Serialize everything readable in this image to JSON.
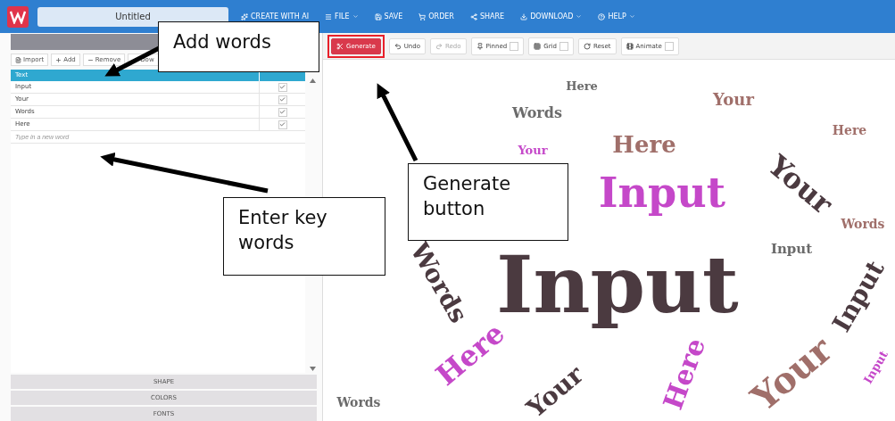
{
  "app_bar": {
    "document_title": "Untitled",
    "menu": [
      {
        "label": "CREATE WITH AI",
        "kind": "ai",
        "dropdown": false
      },
      {
        "label": "FILE",
        "kind": "menu",
        "dropdown": true
      },
      {
        "label": "SAVE",
        "kind": "save",
        "dropdown": false
      },
      {
        "label": "ORDER",
        "kind": "cart",
        "dropdown": false
      },
      {
        "label": "SHARE",
        "kind": "share",
        "dropdown": false
      },
      {
        "label": "DOWNLOAD",
        "kind": "download",
        "dropdown": true
      },
      {
        "label": "HELP",
        "kind": "help",
        "dropdown": true
      }
    ]
  },
  "words_panel": {
    "toolbar": [
      {
        "label": "Import",
        "kind": "file"
      },
      {
        "label": "Add",
        "kind": "plus"
      },
      {
        "label": "Remove",
        "kind": "minus"
      },
      {
        "label": "Dow",
        "kind": "down"
      }
    ],
    "column": "Text",
    "rows": [
      {
        "text": "Input",
        "checked": true
      },
      {
        "text": "Your",
        "checked": true
      },
      {
        "text": "Words",
        "checked": true
      },
      {
        "text": "Here",
        "checked": true
      }
    ],
    "new_word": {
      "placeholder": "Type in a new word"
    },
    "sections": [
      "SHAPE",
      "COLORS",
      "FONTS"
    ]
  },
  "toolbar": [
    {
      "label": "Generate",
      "kind": "primary",
      "toggle": false,
      "highlighted": true
    },
    {
      "label": "Undo",
      "kind": "undo",
      "toggle": false,
      "highlighted": false
    },
    {
      "label": "Redo",
      "kind": "redo",
      "toggle": false,
      "highlighted": false,
      "disabled": true
    },
    {
      "label": "Pinned",
      "kind": "pin",
      "toggle": true,
      "highlighted": false,
      "checked": false
    },
    {
      "label": "Grid",
      "kind": "grid",
      "toggle": true,
      "highlighted": false,
      "checked": false
    },
    {
      "label": "Reset",
      "kind": "reset",
      "toggle": false,
      "highlighted": false
    },
    {
      "label": "Animate",
      "kind": "film",
      "toggle": true,
      "highlighted": false,
      "checked": false
    }
  ],
  "word_cloud": {
    "words": [
      {
        "text": "Your",
        "color": "#a06f6a"
      },
      {
        "text": "Words",
        "color": "#6b6b6b"
      },
      {
        "text": "Here",
        "color": "#a06f6a"
      },
      {
        "text": "Here",
        "color": "#a06f6a"
      },
      {
        "text": "Input",
        "color": "#c548c9"
      },
      {
        "text": "Your",
        "color": "#4b3a40"
      },
      {
        "text": "Input",
        "color": "#4b3a40"
      },
      {
        "text": "Input",
        "color": "#6b6b6b"
      },
      {
        "text": "Words",
        "color": "#4b3a40"
      },
      {
        "text": "Input",
        "color": "#4b3a40"
      },
      {
        "text": "Here",
        "color": "#c548c9"
      },
      {
        "text": "Your",
        "color": "#4b3a40"
      },
      {
        "text": "Here",
        "color": "#c548c9"
      },
      {
        "text": "Your",
        "color": "#a06f6a"
      },
      {
        "text": "Here",
        "color": "#6b6b6b"
      },
      {
        "text": "Words",
        "color": "#a06f6a"
      },
      {
        "text": "Words",
        "color": "#6b6b6b"
      },
      {
        "text": "Input",
        "color": "#c548c9"
      },
      {
        "text": "Your",
        "color": "#c548c9"
      }
    ]
  },
  "annotations": [
    {
      "text": "Add words"
    },
    {
      "text": "Generate button"
    },
    {
      "text": "Enter key words"
    }
  ]
}
